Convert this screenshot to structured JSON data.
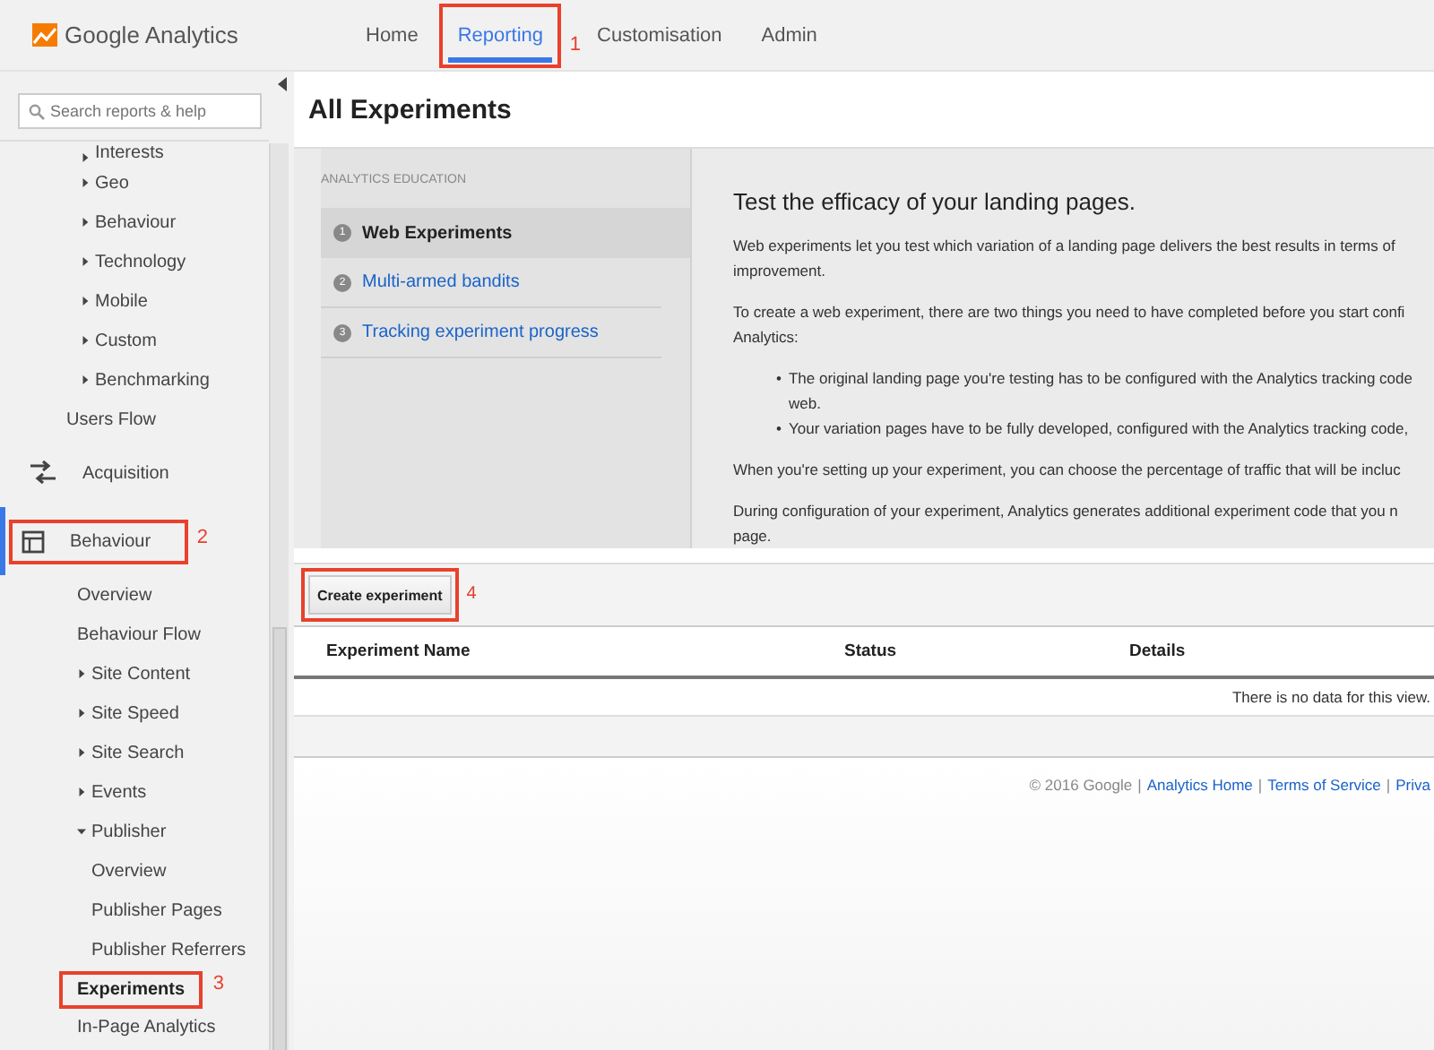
{
  "header": {
    "logo_text": "Google Analytics",
    "tabs": [
      {
        "label": "Home",
        "selected": false
      },
      {
        "label": "Reporting",
        "selected": true,
        "callout": "1"
      },
      {
        "label": "Customisation",
        "selected": false
      },
      {
        "label": "Admin",
        "selected": false
      }
    ]
  },
  "sidebar": {
    "search": {
      "placeholder": "Search reports & help"
    },
    "items": [
      {
        "kind": "item",
        "label": "Interests",
        "expanded": false
      },
      {
        "kind": "item",
        "label": "Geo",
        "expanded": false
      },
      {
        "kind": "item",
        "label": "Behaviour",
        "expanded": false
      },
      {
        "kind": "item",
        "label": "Technology",
        "expanded": false
      },
      {
        "kind": "item",
        "label": "Mobile",
        "expanded": false
      },
      {
        "kind": "item",
        "label": "Custom",
        "expanded": false
      },
      {
        "kind": "item",
        "label": "Benchmarking",
        "expanded": false
      },
      {
        "kind": "leaf",
        "label": "Users Flow",
        "selected": false
      },
      {
        "kind": "section",
        "label": "Acquisition",
        "selected": false
      },
      {
        "kind": "section",
        "label": "Behaviour",
        "selected": true,
        "callout": "2",
        "children": [
          {
            "kind": "leaf",
            "label": "Overview",
            "selected": false
          },
          {
            "kind": "leaf",
            "label": "Behaviour Flow",
            "selected": false
          },
          {
            "kind": "item",
            "label": "Site Content",
            "expanded": false
          },
          {
            "kind": "item",
            "label": "Site Speed",
            "expanded": false
          },
          {
            "kind": "item",
            "label": "Site Search",
            "expanded": false
          },
          {
            "kind": "item",
            "label": "Events",
            "expanded": false
          },
          {
            "kind": "item",
            "label": "Publisher",
            "expanded": true,
            "children": [
              {
                "kind": "leaf",
                "label": "Overview",
                "selected": false
              },
              {
                "kind": "leaf",
                "label": "Publisher Pages",
                "selected": false
              },
              {
                "kind": "leaf",
                "label": "Publisher Referrers",
                "selected": false
              }
            ]
          },
          {
            "kind": "leaf",
            "label": "Experiments",
            "selected": true,
            "callout": "3"
          },
          {
            "kind": "leaf",
            "label": "In-Page Analytics",
            "selected": false
          }
        ]
      }
    ]
  },
  "main": {
    "title": "All Experiments",
    "education": {
      "heading": "ANALYTICS EDUCATION",
      "steps": [
        {
          "number": "1",
          "label": "Web Experiments",
          "selected": true
        },
        {
          "number": "2",
          "label": "Multi-armed bandits",
          "selected": false
        },
        {
          "number": "3",
          "label": "Tracking experiment progress",
          "selected": false
        }
      ],
      "title": "Test the efficacy of your landing pages.",
      "blocks": [
        {
          "kind": "paragraph",
          "text": "Web experiments let you test which variation of a landing page delivers the best results in terms of improvement."
        },
        {
          "kind": "paragraph",
          "text": "To create a web experiment, there are two things you need to have completed before you start confi Analytics:"
        },
        {
          "kind": "bullets",
          "items": [
            {
              "marker": "•",
              "text": "The original landing page you're testing has to be configured with the Analytics tracking code web."
            },
            {
              "marker": "•",
              "text": "Your variation pages have to be fully developed, configured with the Analytics tracking code,"
            }
          ]
        },
        {
          "kind": "paragraph",
          "text": "When you're setting up your experiment, you can choose the percentage of traffic that will be incluc"
        },
        {
          "kind": "paragraph",
          "text": "During configuration of your experiment, Analytics generates additional experiment code that you n page."
        }
      ]
    },
    "create_button": {
      "label": "Create experiment",
      "callout": "4"
    },
    "table": {
      "columns": [
        "Experiment Name",
        "Status",
        "Details"
      ],
      "empty_message": "There is no data for this view."
    },
    "footer": {
      "parts": [
        {
          "kind": "text",
          "text": "© 2016 Google"
        },
        {
          "kind": "separator",
          "text": "|"
        },
        {
          "kind": "link",
          "text": "Analytics Home"
        },
        {
          "kind": "separator",
          "text": "|"
        },
        {
          "kind": "link",
          "text": "Terms of Service"
        },
        {
          "kind": "separator",
          "text": "|"
        },
        {
          "kind": "link",
          "text": "Priva"
        }
      ]
    }
  }
}
